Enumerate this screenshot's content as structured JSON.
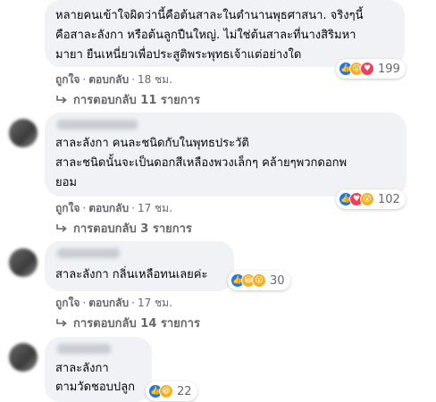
{
  "comments": [
    {
      "text_lines": [
        "หลายคนเข้าใจผิดว่านี้คือต้นสาละในตำนานพุธศาสนา. จริงๆนี้",
        "คือสาละลังกา หรือต้นลูกปืนใหญ่. ไม่ใช่ต้นสาละที่นางสิริมหา",
        "มายา ยืนเหนี่ยวเพื่อประสูติพระพุทธเจ้าแต่อย่างใด"
      ],
      "reactions": [
        "like",
        "wow",
        "love"
      ],
      "reaction_count": "199",
      "like_label": "ถูกใจ",
      "reply_label": "ตอบกลับ",
      "time": "18 ชม.",
      "replies_label": "การตอบกลับ 11 รายการ"
    },
    {
      "text_lines": [
        "สาละลังกา คนละชนิดกับในพุทธประวัติ",
        "สาละชนิดนั้นจะเป็นดอกสีเหลืองพวงเล็กๆ คล้ายๆพวกดอกพ",
        "ยอม"
      ],
      "reactions": [
        "like",
        "love",
        "wow"
      ],
      "reaction_count": "102",
      "like_label": "ถูกใจ",
      "reply_label": "ตอบกลับ",
      "time": "17 ชม.",
      "replies_label": "การตอบกลับ 3 รายการ"
    },
    {
      "text_lines": [
        "สาละลังกา กลิ่นเหลือทนเลยค่ะ"
      ],
      "reactions": [
        "like",
        "haha",
        "wow"
      ],
      "reaction_count": "30",
      "like_label": "ถูกใจ",
      "reply_label": "ตอบกลับ",
      "time": "17 ชม.",
      "replies_label": "การตอบกลับ 14 รายการ"
    },
    {
      "text_lines": [
        "สาละลังกา",
        "ตามวัดชอบปลูก"
      ],
      "reactions": [
        "like",
        "haha"
      ],
      "reaction_count": "22"
    }
  ],
  "colors": {
    "bubble": "#f0f2f5",
    "secondary_text": "#65676b",
    "like_blue": "#1877f2",
    "love_red": "#f33e58",
    "emoji_yellow": "#f7b125"
  }
}
